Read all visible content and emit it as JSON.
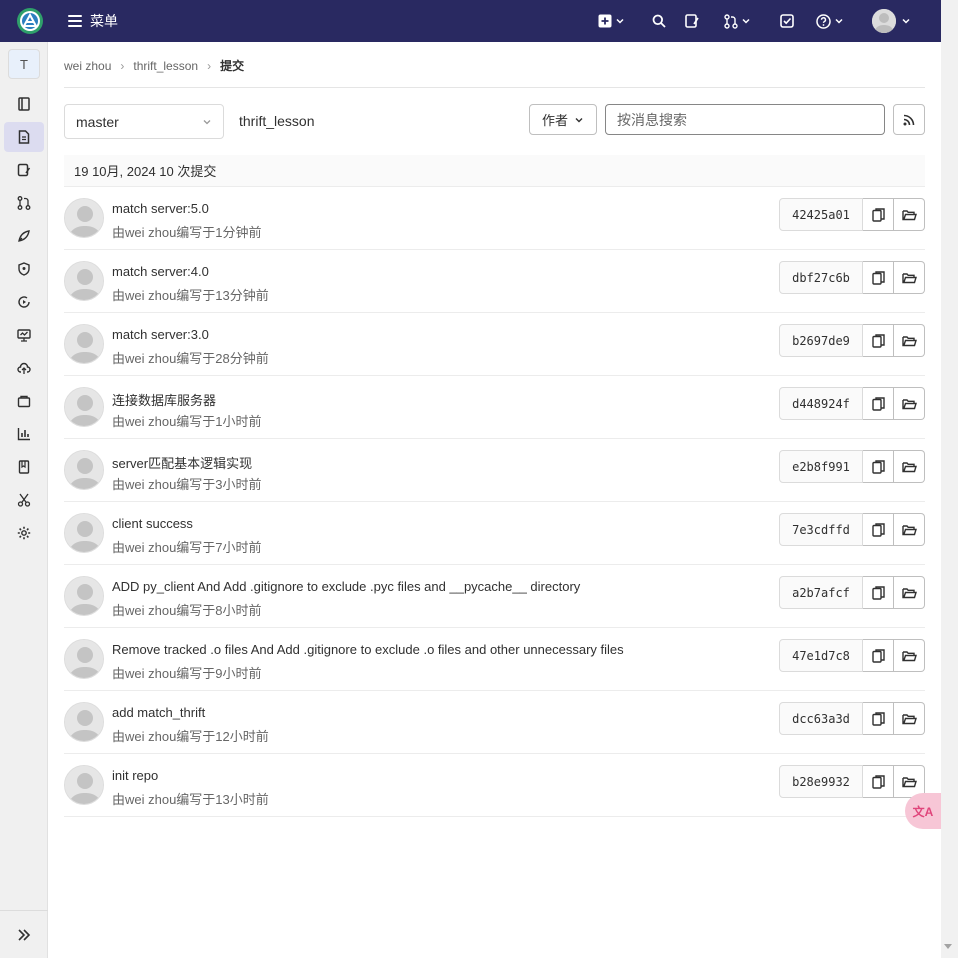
{
  "topbar": {
    "menu_label": "菜单",
    "colors": {
      "background": "#292961",
      "icon": "#ffffff"
    }
  },
  "sidebar": {
    "project_letter": "T",
    "items": [
      {
        "name": "project-overview-icon"
      },
      {
        "name": "repository-icon",
        "active": true
      },
      {
        "name": "issues-icon"
      },
      {
        "name": "merge-requests-icon"
      },
      {
        "name": "cicd-icon"
      },
      {
        "name": "security-icon"
      },
      {
        "name": "deployments-icon"
      },
      {
        "name": "monitor-icon"
      },
      {
        "name": "infrastructure-icon"
      },
      {
        "name": "packages-icon"
      },
      {
        "name": "analytics-icon"
      },
      {
        "name": "wiki-icon"
      },
      {
        "name": "snippets-icon"
      },
      {
        "name": "settings-icon"
      }
    ]
  },
  "breadcrumb": {
    "owner": "wei zhou",
    "project": "thrift_lesson",
    "current": "提交"
  },
  "toolbar": {
    "branch": "master",
    "path": "thrift_lesson",
    "author_label": "作者",
    "search_placeholder": "按消息搜索"
  },
  "day_header": "19 10月, 2024 10 次提交",
  "commits": [
    {
      "title": "match server:5.0",
      "meta": "由wei zhou编写于1分钟前",
      "sha": "42425a01"
    },
    {
      "title": "match server:4.0",
      "meta": "由wei zhou编写于13分钟前",
      "sha": "dbf27c6b"
    },
    {
      "title": "match server:3.0",
      "meta": "由wei zhou编写于28分钟前",
      "sha": "b2697de9"
    },
    {
      "title": "连接数据库服务器",
      "meta": "由wei zhou编写于1小时前",
      "sha": "d448924f"
    },
    {
      "title": "server匹配基本逻辑实现",
      "meta": "由wei zhou编写于3小时前",
      "sha": "e2b8f991"
    },
    {
      "title": "client success",
      "meta": "由wei zhou编写于7小时前",
      "sha": "7e3cdffd"
    },
    {
      "title": "ADD py_client And Add .gitignore to exclude .pyc files and __pycache__ directory",
      "meta": "由wei zhou编写于8小时前",
      "sha": "a2b7afcf"
    },
    {
      "title": "Remove tracked .o files And Add .gitignore to exclude .o files and other unnecessary files",
      "meta": "由wei zhou编写于9小时前",
      "sha": "47e1d7c8"
    },
    {
      "title": "add match_thrift",
      "meta": "由wei zhou编写于12小时前",
      "sha": "dcc63a3d"
    },
    {
      "title": "init repo",
      "meta": "由wei zhou编写于13小时前",
      "sha": "b28e9932"
    }
  ],
  "float_translate_label": "文A"
}
